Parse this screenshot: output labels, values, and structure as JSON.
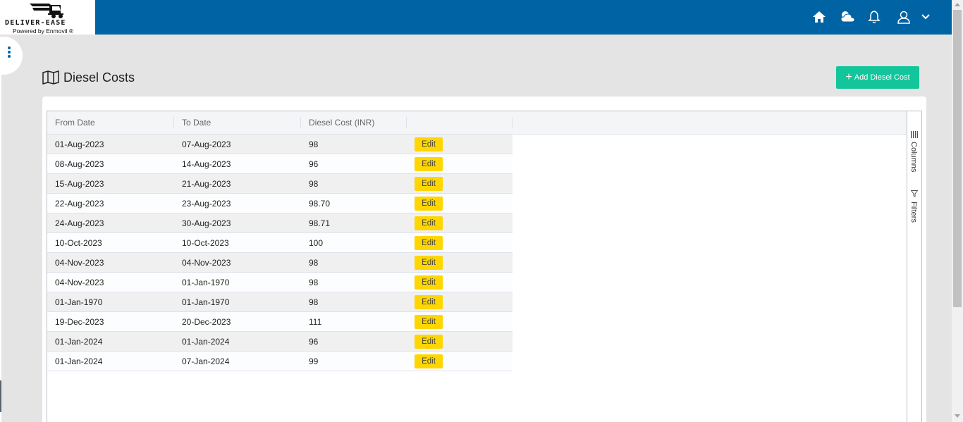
{
  "brand": {
    "name": "DELIVER-EASE",
    "powered_by": "Powered by Enmovil ®"
  },
  "topbar_icons": [
    "home-icon",
    "weather-icon",
    "bell-icon",
    "user-icon",
    "chevron-down-icon"
  ],
  "colors": {
    "topbar": "#0064a4",
    "add_button": "#13c59a",
    "edit_button": "#ffd600"
  },
  "page": {
    "title": "Diesel Costs",
    "title_icon": "map-icon",
    "add_button_label": "Add Diesel Cost"
  },
  "grid": {
    "columns": [
      "From Date",
      "To Date",
      "Diesel Cost (INR)",
      ""
    ],
    "rows": [
      {
        "from": "01-Aug-2023",
        "to": "07-Aug-2023",
        "cost": "98",
        "action": "Edit"
      },
      {
        "from": "08-Aug-2023",
        "to": "14-Aug-2023",
        "cost": "96",
        "action": "Edit"
      },
      {
        "from": "15-Aug-2023",
        "to": "21-Aug-2023",
        "cost": "98",
        "action": "Edit"
      },
      {
        "from": "22-Aug-2023",
        "to": "23-Aug-2023",
        "cost": "98.70",
        "action": "Edit"
      },
      {
        "from": "24-Aug-2023",
        "to": "30-Aug-2023",
        "cost": "98.71",
        "action": "Edit"
      },
      {
        "from": "10-Oct-2023",
        "to": "10-Oct-2023",
        "cost": "100",
        "action": "Edit"
      },
      {
        "from": "04-Nov-2023",
        "to": "04-Nov-2023",
        "cost": "98",
        "action": "Edit"
      },
      {
        "from": "04-Nov-2023",
        "to": "01-Jan-1970",
        "cost": "98",
        "action": "Edit"
      },
      {
        "from": "01-Jan-1970",
        "to": "01-Jan-1970",
        "cost": "98",
        "action": "Edit"
      },
      {
        "from": "19-Dec-2023",
        "to": "20-Dec-2023",
        "cost": "111",
        "action": "Edit"
      },
      {
        "from": "01-Jan-2024",
        "to": "01-Jan-2024",
        "cost": "96",
        "action": "Edit"
      },
      {
        "from": "01-Jan-2024",
        "to": "07-Jan-2024",
        "cost": "99",
        "action": "Edit"
      }
    ],
    "side_tabs": [
      "Columns",
      "Filters"
    ]
  }
}
